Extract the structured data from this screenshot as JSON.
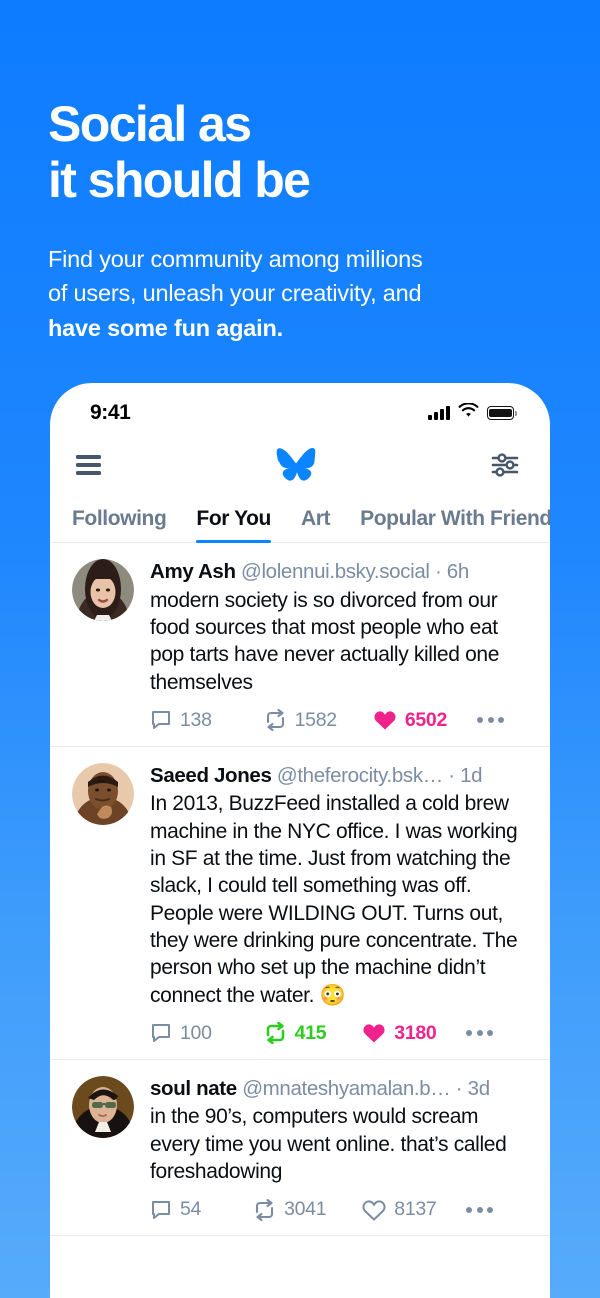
{
  "hero": {
    "headline_line1": "Social as",
    "headline_line2": "it should be",
    "subhead_line1": "Find your community among millions",
    "subhead_line2": "of users, unleash your creativity, and",
    "subhead_bold": "have some fun again."
  },
  "colors": {
    "background_top": "#0d7cff",
    "background_bottom": "#57abfb",
    "brand_blue": "#0a85ff",
    "like_pink": "#f0228c",
    "repost_green": "#2ecc22",
    "muted_slate": "#7c8da3",
    "icon_slate": "#46566b"
  },
  "phone": {
    "statusbar": {
      "time": "9:41",
      "cellular_icon": "cellular-bars-icon",
      "wifi_icon": "wifi-icon",
      "battery_icon": "battery-full-icon"
    },
    "appbar": {
      "menu_icon": "hamburger-menu-icon",
      "logo_icon": "bluesky-butterfly-logo",
      "settings_icon": "feed-sliders-icon"
    },
    "tabs": [
      {
        "label": "Following",
        "active": false
      },
      {
        "label": "For You",
        "active": true
      },
      {
        "label": "Art",
        "active": false
      },
      {
        "label": "Popular With Friends",
        "active": false
      }
    ],
    "posts": [
      {
        "display_name": "Amy Ash",
        "handle": "@lolennui.bsky.social",
        "separator": "·",
        "time": "6h",
        "text": "modern society is so divorced from our food sources that most people who eat pop tarts have never actually killed one themselves",
        "reply_count": "138",
        "repost_count": "1582",
        "like_count": "6502",
        "reposted": false,
        "liked": true,
        "avatar": "photo-woman-dark-hair"
      },
      {
        "display_name": "Saeed Jones",
        "handle": "@theferocity.bsk…",
        "separator": "·",
        "time": "1d",
        "text": "In 2013, BuzzFeed installed a cold brew machine in the NYC office. I was working in SF at the time. Just from watching the slack, I could tell something was off. People were WILDING OUT. Turns out, they were drinking pure concentrate. The person who set up the machine didn’t connect the water. 😳",
        "reply_count": "100",
        "repost_count": "415",
        "like_count": "3180",
        "reposted": true,
        "liked": true,
        "avatar": "photo-man-hand-on-chin"
      },
      {
        "display_name": "soul nate",
        "handle": "@mnateshyamalan.b…",
        "separator": "·",
        "time": "3d",
        "text": "in the 90’s, computers would scream every time you went online. that’s called foreshadowing",
        "reply_count": "54",
        "repost_count": "3041",
        "like_count": "8137",
        "reposted": false,
        "liked": false,
        "avatar": "painting-portrait-sunglasses"
      }
    ]
  }
}
